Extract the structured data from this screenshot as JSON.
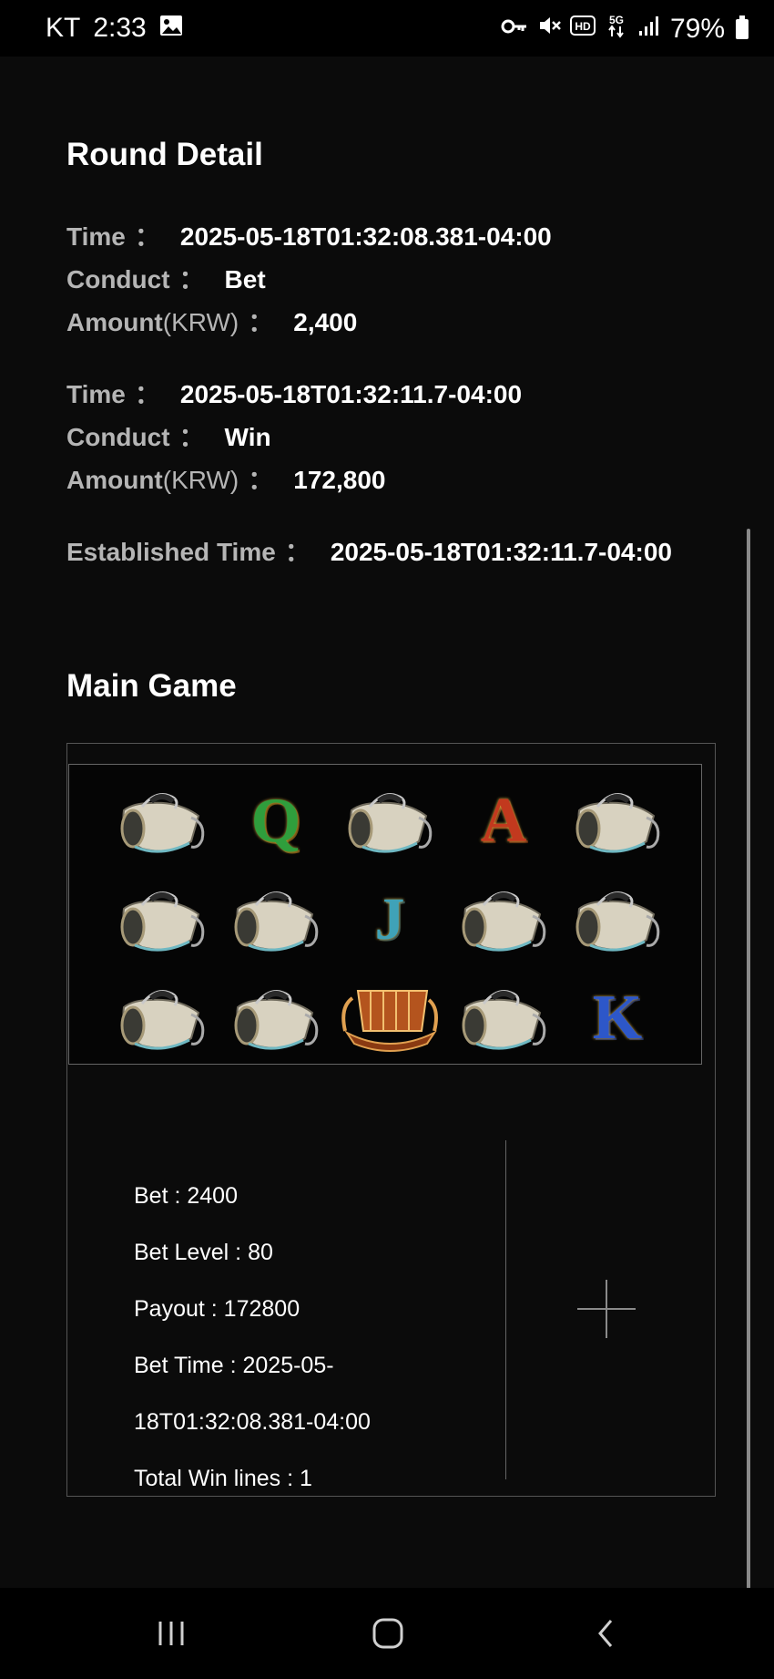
{
  "status_bar": {
    "carrier": "KT",
    "time": "2:33",
    "battery": "79%",
    "icons": [
      "gallery-icon",
      "key-icon",
      "mute-icon",
      "hd-icon",
      "5g-icon",
      "signal-icon",
      "battery-icon"
    ]
  },
  "round_detail": {
    "title": "Round Detail",
    "entries": [
      {
        "time_label": "Time",
        "time_value": "2025-05-18T01:32:08.381-04:00",
        "conduct_label": "Conduct",
        "conduct_value": "Bet",
        "amount_label": "Amount",
        "amount_unit": "(KRW)",
        "amount_value": "2,400"
      },
      {
        "time_label": "Time",
        "time_value": "2025-05-18T01:32:11.7-04:00",
        "conduct_label": "Conduct",
        "conduct_value": "Win",
        "amount_label": "Amount",
        "amount_unit": "(KRW)",
        "amount_value": "172,800"
      }
    ],
    "established_label": "Established Time",
    "established_value": "2025-05-18T01:32:11.7-04:00",
    "colon": "："
  },
  "main_game": {
    "title": "Main Game",
    "reels": [
      [
        "horn",
        "Q",
        "horn",
        "A",
        "horn"
      ],
      [
        "horn",
        "horn",
        "J",
        "horn",
        "horn"
      ],
      [
        "horn",
        "horn",
        "ship",
        "horn",
        "K"
      ]
    ],
    "info": {
      "bet": "Bet : 2400",
      "bet_level": "Bet Level : 80",
      "payout": "Payout : 172800",
      "bet_time_1": "Bet Time : 2025-05-",
      "bet_time_2": "18T01:32:08.381-04:00",
      "total_win_lines": "Total Win lines : 1"
    }
  },
  "nav_bar": {
    "icons": [
      "recent-apps-icon",
      "home-icon",
      "back-icon"
    ]
  }
}
